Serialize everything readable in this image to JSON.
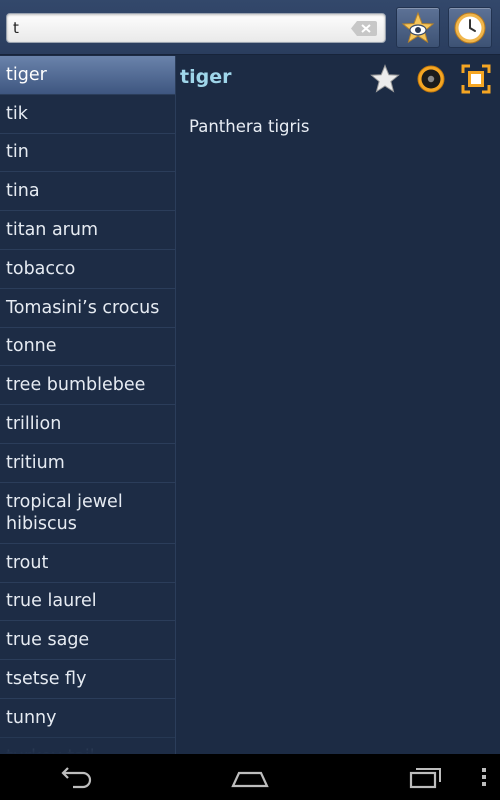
{
  "search": {
    "value": "t"
  },
  "list": {
    "items": [
      "tiger",
      "tik",
      "tin",
      "tina",
      "titan arum",
      "tobacco",
      "Tomasini’s crocus",
      "tonne",
      "tree bumblebee",
      "trillion",
      "tritium",
      "tropical jewel hibiscus",
      "trout",
      "true laurel",
      "true sage",
      "tsetse fly",
      "tunny",
      "turkey tail"
    ],
    "selected": "tiger"
  },
  "detail": {
    "term": "tiger",
    "definition": "Panthera tigris"
  },
  "icons": {
    "top_favorites": "star-eye-icon",
    "top_history": "clock-icon",
    "clear": "clear-text-icon",
    "favorite": "star-icon",
    "audio": "speaker-icon",
    "expand": "expand-icon",
    "back": "back-icon",
    "home": "home-icon",
    "recent": "recent-apps-icon",
    "menu": "overflow-menu-icon"
  },
  "colors": {
    "background": "#1c2b44",
    "term": "#9fd6ea",
    "selected_row": "#5a74a0",
    "accent_orange": "#f5a623"
  }
}
